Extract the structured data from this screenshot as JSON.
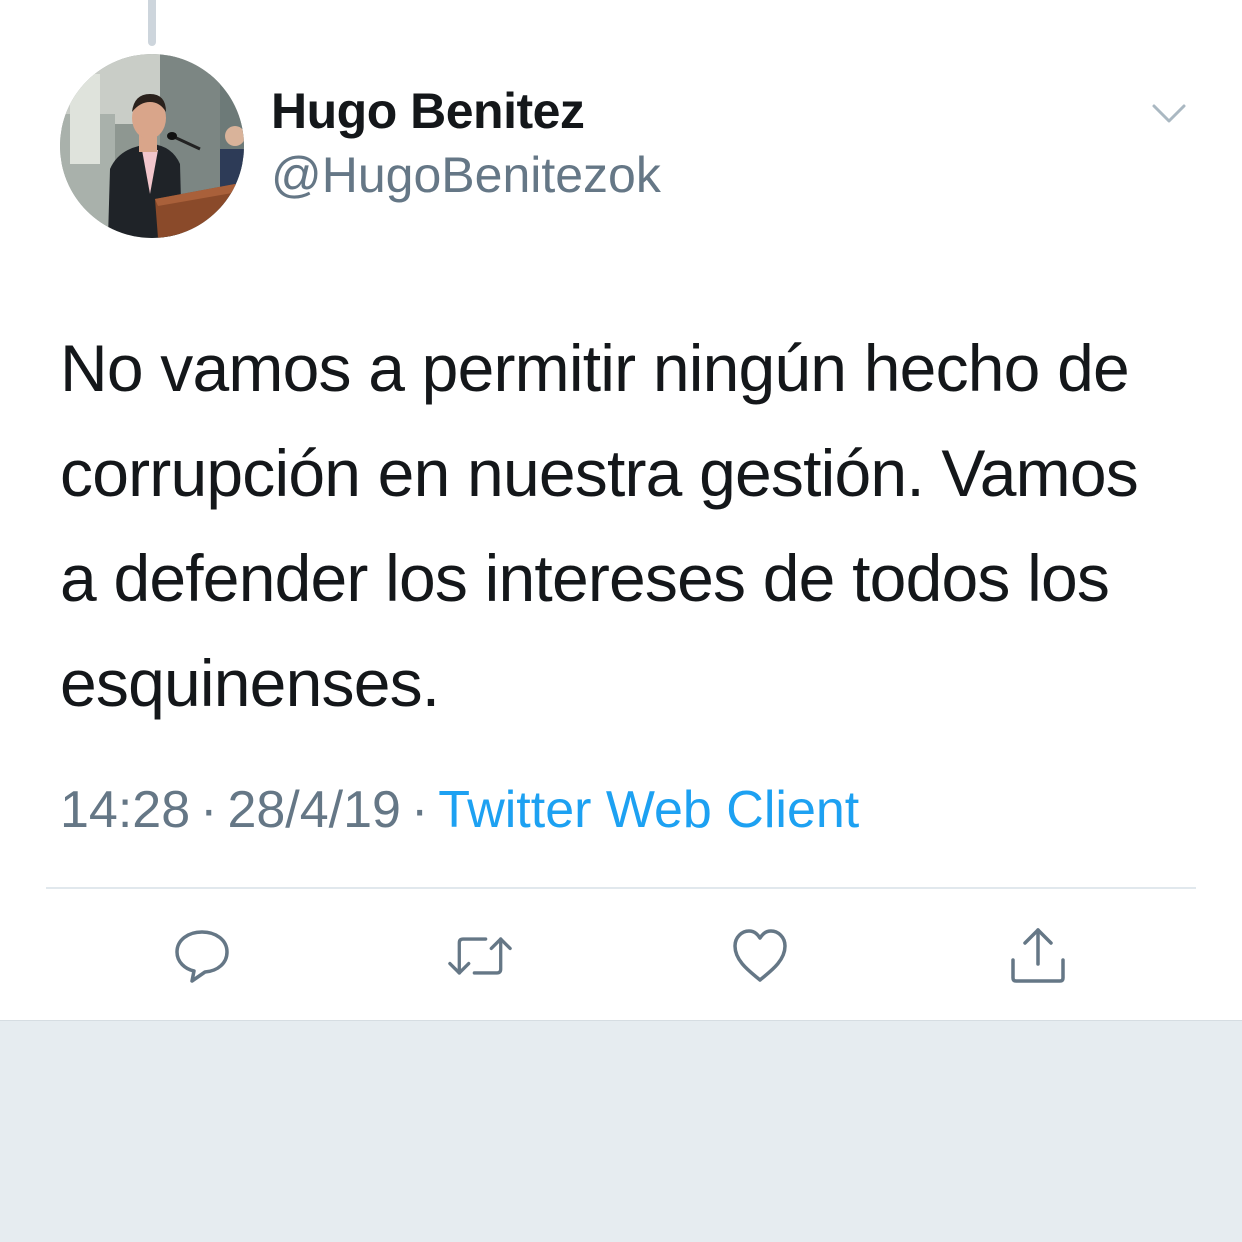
{
  "tweet": {
    "display_name": "Hugo Benitez",
    "screen_name": "@HugoBenitezok",
    "text": "No vamos a permitir ningún hecho de corrupción en nuestra gestión. Vamos a defender los intereses de todos los esquinenses.",
    "time": "14:28",
    "date": "28/4/19",
    "separator": "·",
    "source": "Twitter Web Client"
  },
  "icons": {
    "menu": "chevron-down-icon",
    "reply": "reply-icon",
    "retweet": "retweet-icon",
    "like": "heart-icon",
    "share": "share-icon"
  },
  "colors": {
    "text_primary": "#14171a",
    "text_secondary": "#657786",
    "accent": "#1da1f2",
    "icon": "#657786",
    "page_background": "#e6ecf0"
  }
}
